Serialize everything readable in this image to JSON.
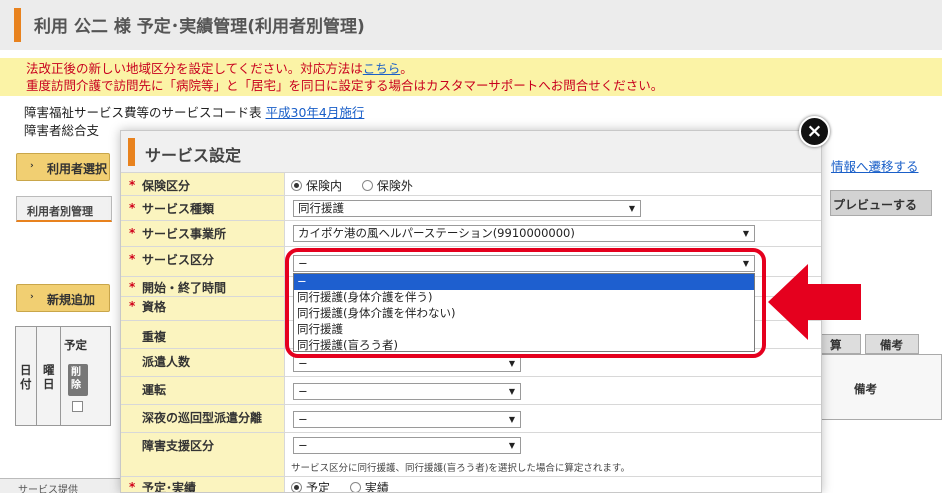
{
  "page_title": "利用 公二 様 予定･実績管理(利用者別管理)",
  "notice": {
    "line1": "法改正後の新しい地域区分を設定してください。対応方法は",
    "line1_link": "こちら",
    "line1_end": "。",
    "line2": "重度訪問介護で訪問先に「病院等」と「居宅」を同日に設定する場合はカスタマーサポートへお問合せください。"
  },
  "info": {
    "line1": "障害福祉サービス費等のサービスコード表",
    "line1_link": "平成30年4月施行",
    "line2": "障害者総合支"
  },
  "bg": {
    "select_user_btn": "利用者選択",
    "tab_label": "利用者別管理",
    "new_add_btn": "新規追加",
    "right_link": "情報へ遷移する",
    "preview_btn": "プレビューする",
    "col_plan": "予定",
    "col_day": "日付",
    "col_weekday": "曜日",
    "col_delete": "削除",
    "col_calc": "算",
    "col_remarks_head": "備考",
    "col_remarks": "備考",
    "bottom_text": "サービス提供"
  },
  "modal": {
    "title": "サービス設定",
    "close_symbol": "×",
    "rows": {
      "insurance": {
        "label": "保険区分",
        "required": true,
        "opt1": "保険内",
        "opt2": "保険外",
        "selected": "保険内"
      },
      "service_type": {
        "label": "サービス種類",
        "required": true,
        "value": "同行援護"
      },
      "provider": {
        "label": "サービス事業所",
        "required": true,
        "value": "カイポケ港の風ヘルパーステーション(9910000000)"
      },
      "service_class": {
        "label": "サービス区分",
        "required": true,
        "value": "−"
      },
      "time": {
        "label": "開始・終了時間",
        "required": true
      },
      "qualification": {
        "label": "資格",
        "required": true
      },
      "duplicate": {
        "label": "重複",
        "required": false
      },
      "dispatch": {
        "label": "派遣人数",
        "required": false,
        "value": "−"
      },
      "driving": {
        "label": "運転",
        "required": false,
        "value": "−"
      },
      "night": {
        "label": "深夜の巡回型派遣分離",
        "required": false,
        "value": "−"
      },
      "support_class": {
        "label": "障害支援区分",
        "required": false,
        "value": "−",
        "note": "サービス区分に同行援護、同行援護(盲ろう者)を選択した場合に算定されます。"
      },
      "plan_actual": {
        "label": "予定･実績",
        "required": true,
        "opt1": "予定",
        "opt2": "実績",
        "selected": "予定"
      }
    },
    "dropdown_options": [
      {
        "label": "−",
        "selected": true
      },
      {
        "label": "同行援護(身体介護を伴う)",
        "selected": false
      },
      {
        "label": "同行援護(身体介護を伴わない)",
        "selected": false
      },
      {
        "label": "同行援護",
        "selected": false
      },
      {
        "label": "同行援護(盲ろう者)",
        "selected": false
      }
    ]
  },
  "colors": {
    "accent": "#e8821e",
    "highlight": "#e5001e",
    "notice_bg": "#fbf3a6",
    "label_bg": "#fbf4bf",
    "selected_option": "#1e5fcf"
  }
}
